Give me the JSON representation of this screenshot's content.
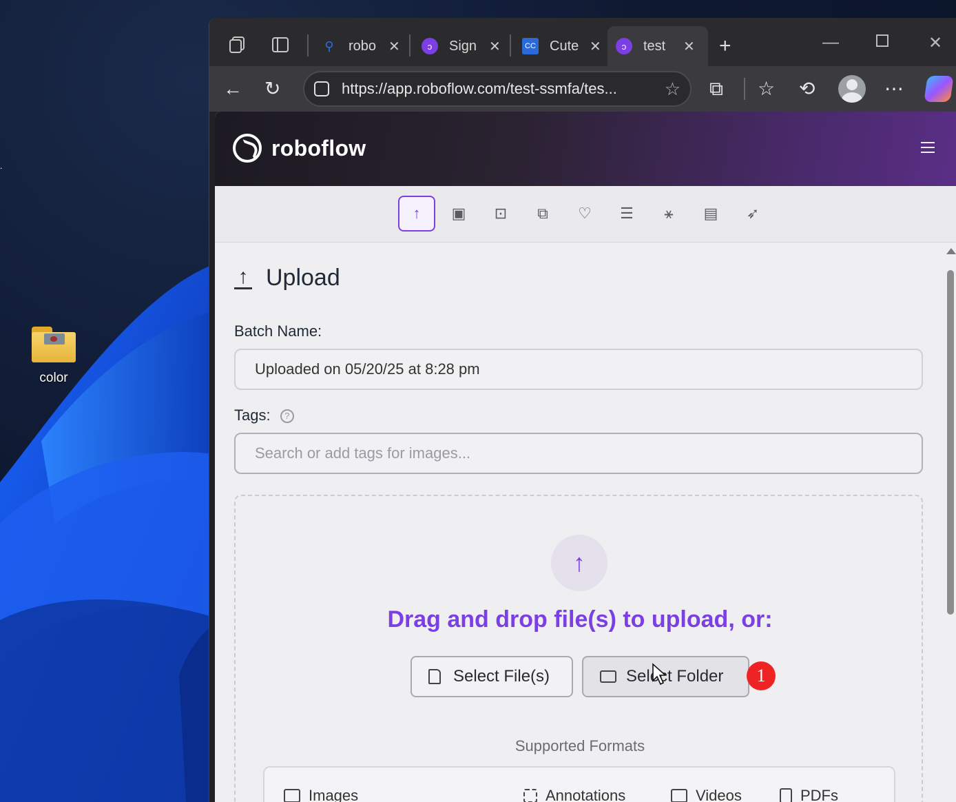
{
  "desktop": {
    "icon_label": "color",
    "edge_text": "."
  },
  "browser": {
    "tabs": [
      {
        "title": "robo",
        "favicon": "search-icon",
        "color": "#2d6cdf"
      },
      {
        "title": "Sign",
        "favicon": "roboflow-icon",
        "color": "#7b3fe4"
      },
      {
        "title": "Cute",
        "favicon": "cc-icon",
        "color": "#2b6ad8"
      },
      {
        "title": "test",
        "favicon": "roboflow-icon",
        "color": "#7b3fe4"
      }
    ],
    "url": "https://app.roboflow.com/test-ssmfa/tes..."
  },
  "app": {
    "brand": "roboflow",
    "toolbar_icons": [
      "upload-icon",
      "annotate-icon",
      "images-icon",
      "versions-icon",
      "health-icon",
      "classes-icon",
      "graph-icon",
      "analytics-icon",
      "deploy-icon"
    ],
    "accent": "#7b3fe4"
  },
  "upload": {
    "title": "Upload",
    "batch_label": "Batch Name:",
    "batch_value": "Uploaded on 05/20/25 at 8:28 pm",
    "tags_label": "Tags:",
    "tags_placeholder": "Search or add tags for images...",
    "help_glyph": "?",
    "drag_text": "Drag and drop file(s) to upload, or:",
    "select_files": "Select File(s)",
    "select_folder": "Select Folder",
    "badge": "1",
    "formats_title": "Supported Formats",
    "formats": [
      "Images",
      "Annotations",
      "Videos",
      "PDFs"
    ]
  }
}
